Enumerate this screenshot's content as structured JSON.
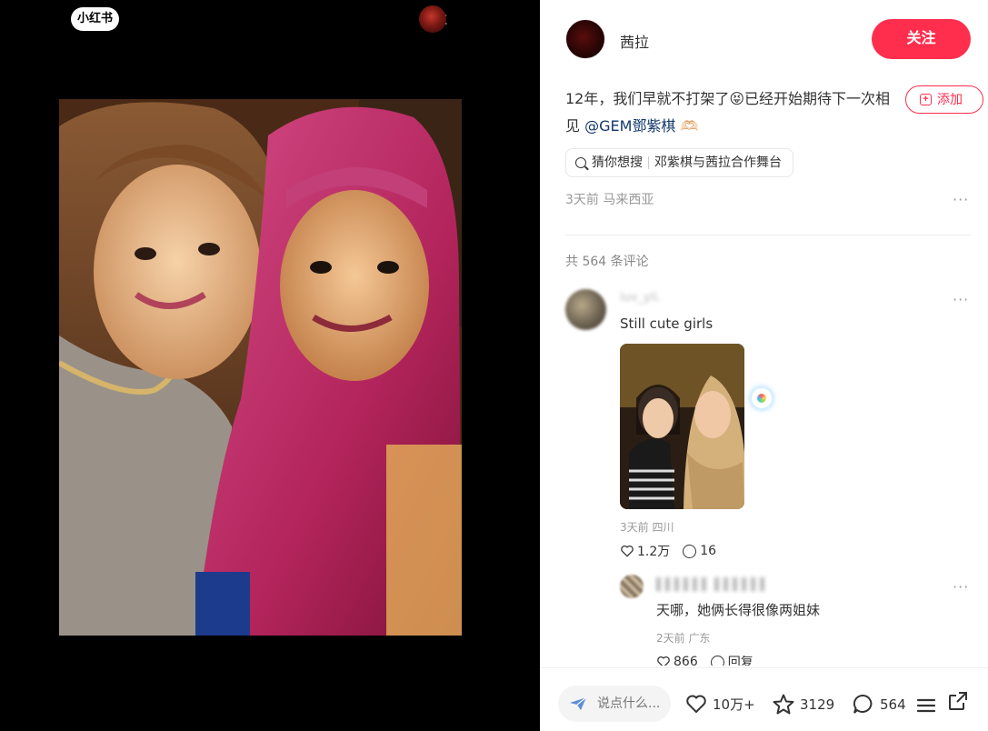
{
  "media": {
    "logo": "小红书",
    "author": "茜拉"
  },
  "note": {
    "author_name": "茜拉",
    "follow_label": "关注",
    "content_text": "12年，我们早就不打架了😝已经开始期待下一次相见 ",
    "mention": "@GEM鄧紫棋",
    "emoji_after": "🫶🏻",
    "add_label": "添加",
    "search_prefix": "猜你想搜",
    "search_query": "邓紫棋与茜拉合作舞台",
    "meta": "3天前 马来西亚",
    "more": "···"
  },
  "comments": {
    "total_label": "共 564 条评论",
    "items": [
      {
        "user": "luv_yli.",
        "text": "Still cute girls",
        "meta": "3天前 四川",
        "likes": "1.2万",
        "replies": "16",
        "more": "···"
      },
      {
        "user": "▌▌▌▌▌▌ ▌▌▌▌▌▌",
        "text": "天哪，她俩长得很像两姐妹",
        "meta": "2天前 广东",
        "likes": "866",
        "reply_label": "回复",
        "more": "···"
      }
    ]
  },
  "bottom_bar": {
    "input_placeholder": "说点什么...",
    "likes": "10万+",
    "stars": "3129",
    "comments": "564"
  },
  "colors": {
    "accent": "#ff2e4d",
    "mention": "#13386c",
    "muted": "#999999"
  }
}
